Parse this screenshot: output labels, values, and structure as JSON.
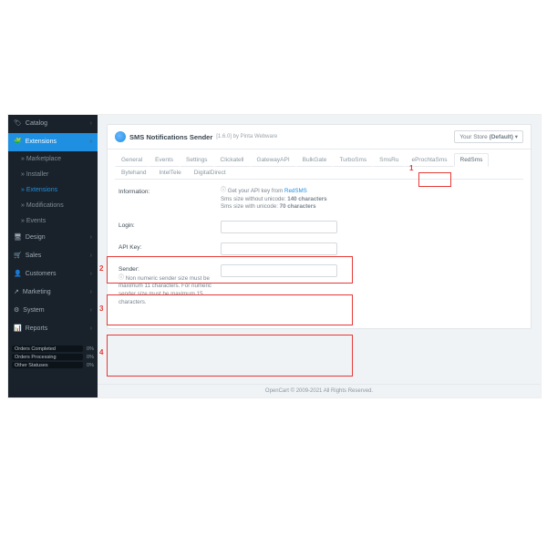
{
  "sidebar": {
    "items": [
      {
        "icon": "🏷",
        "label": "Catalog",
        "expand": true
      },
      {
        "icon": "🧩",
        "label": "Extensions",
        "sel": true,
        "expand": true
      },
      {
        "icon": "🎨",
        "label": "Design",
        "expand": true
      },
      {
        "icon": "📊",
        "label": "Sales",
        "expand": true
      },
      {
        "icon": "👤",
        "label": "Customers",
        "expand": true
      },
      {
        "icon": "📣",
        "label": "Marketing",
        "expand": true
      },
      {
        "icon": "⚙",
        "label": "System",
        "expand": true
      },
      {
        "icon": "📈",
        "label": "Reports",
        "expand": true
      }
    ],
    "subs": [
      {
        "label": "Marketplace"
      },
      {
        "label": "Installer"
      },
      {
        "label": "Extensions",
        "sel": true
      },
      {
        "label": "Modifications"
      },
      {
        "label": "Events"
      }
    ],
    "progress": [
      {
        "label": "Orders Completed",
        "pct": "0%"
      },
      {
        "label": "Orders Processing",
        "pct": "0%"
      },
      {
        "label": "Other Statuses",
        "pct": "0%"
      }
    ]
  },
  "header": {
    "title": "SMS Notifications Sender",
    "subtitle": "[1.6.0] by Pinta Webware",
    "store_label": "Your Store",
    "store_value": "(Default)"
  },
  "tabs": [
    "General",
    "Events",
    "Settings",
    "Clickatell",
    "GatewayAPI",
    "BulkGate",
    "TurboSms",
    "SmsRu",
    "eProchtaSms",
    "RedSms",
    "Bytehand",
    "IntelTele",
    "DigitalDirect"
  ],
  "active_tab": "RedSms",
  "form": {
    "info_label": "Information:",
    "info_line1_pre": "Get your API key from ",
    "info_line1_link": "RedSMS",
    "info_line2_a": "Sms size without unicode: ",
    "info_line2_b": "140 characters",
    "info_line3_a": "Sms size with unicode: ",
    "info_line3_b": "70 characters",
    "login_label": "Login:",
    "apikey_label": "API Key:",
    "sender_label": "Sender:",
    "sender_hint": "Non numeric sender size must be maximum 11 characters. For numeric sender size must be maximum 15 characters."
  },
  "footer": "OpenCart © 2009-2021 All Rights Reserved.",
  "annotations": [
    "1",
    "2",
    "3",
    "4"
  ]
}
